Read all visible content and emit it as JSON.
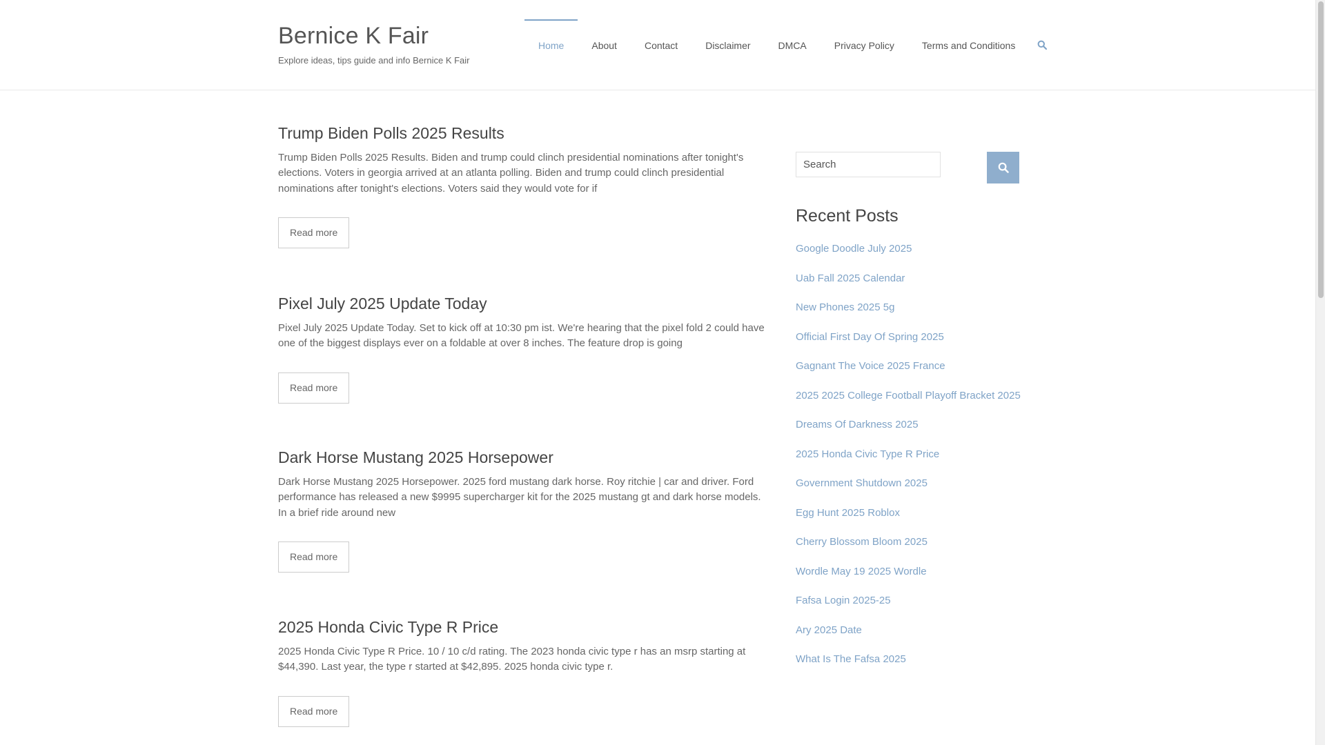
{
  "header": {
    "site_title": "Bernice K Fair",
    "site_description": "Explore ideas, tips guide and info Bernice K Fair",
    "nav": [
      {
        "label": "Home",
        "active": true
      },
      {
        "label": "About"
      },
      {
        "label": "Contact"
      },
      {
        "label": "Disclaimer"
      },
      {
        "label": "DMCA"
      },
      {
        "label": "Privacy Policy"
      },
      {
        "label": "Terms and Conditions"
      }
    ],
    "search_icon": "search-icon"
  },
  "posts": [
    {
      "title": "Trump Biden Polls 2025 Results",
      "excerpt": "Trump Biden Polls 2025 Results. Biden and trump could clinch presidential nominations after tonight's elections. Voters in georgia arrived at an atlanta polling. Biden and trump could clinch presidential nominations after tonight's elections. Voters said they would vote for if",
      "read_more": "Read more"
    },
    {
      "title": "Pixel July 2025 Update Today",
      "excerpt": "Pixel July 2025 Update Today. Set to kick off at 10:30 pm ist. We're hearing that the pixel fold 2 could have one of the biggest displays ever on a foldable at over 8 inches. The feature drop is going",
      "read_more": "Read more"
    },
    {
      "title": "Dark Horse Mustang 2025 Horsepower",
      "excerpt": "Dark Horse Mustang 2025 Horsepower. 2025 ford mustang dark horse. Roy ritchie | car and driver. Ford performance has released a new $9995 supercharger kit for the 2025 mustang gt and dark horse models. In a brief ride around new",
      "read_more": "Read more"
    },
    {
      "title": "2025 Honda Civic Type R Price",
      "excerpt": "2025 Honda Civic Type R Price. 10 / 10 c/d rating. The 2023 honda civic type r has an msrp starting at $44,390. Last year, the type r started at $42,895. 2025 honda civic type r.",
      "read_more": "Read more"
    }
  ],
  "sidebar": {
    "search_placeholder": "Search",
    "search_button_icon": "search-icon",
    "recent_title": "Recent Posts",
    "recent_posts": [
      "Google Doodle July 2025",
      "Uab Fall 2025 Calendar",
      "New Phones 2025 5g",
      "Official First Day Of Spring 2025",
      "Gagnant The Voice 2025 France",
      "2025 2025 College Football Playoff Bracket 2025",
      "Dreams Of Darkness 2025",
      "2025 Honda Civic Type R Price",
      "Government Shutdown 2025",
      "Egg Hunt 2025 Roblox",
      "Cherry Blossom Bloom 2025",
      "Wordle May 19 2025 Wordle",
      "Fafsa Login 2025-25",
      "Ary 2025 Date",
      "What Is The Fafsa 2025"
    ]
  },
  "colors": {
    "accent": "#7fa3c7",
    "button": "#8faecd",
    "text": "#555555"
  }
}
